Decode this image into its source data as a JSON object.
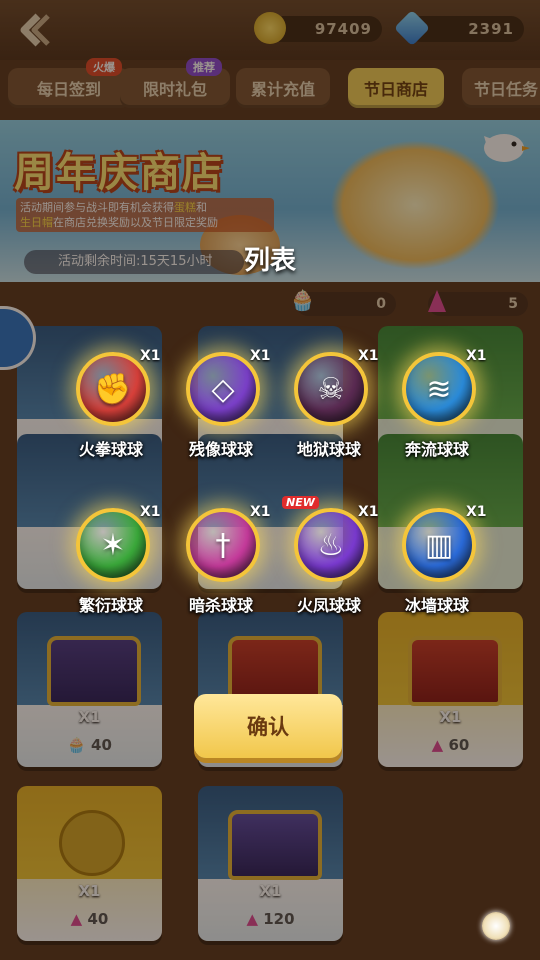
{
  "topbar": {
    "coins": "97409",
    "diamonds": "2391"
  },
  "tabs": [
    {
      "label": "每日签到",
      "tag": "火爆",
      "active": false
    },
    {
      "label": "限时礼包",
      "tag": "推荐",
      "active": false
    },
    {
      "label": "累计充值",
      "tag": "",
      "active": false
    },
    {
      "label": "节日商店",
      "tag": "",
      "active": true
    },
    {
      "label": "节日任务",
      "tag": "",
      "active": false
    }
  ],
  "banner": {
    "title": "周年庆商店",
    "desc_1": "活动期间参与战斗即有机会获得",
    "desc_hl1": "蛋糕",
    "desc_2": "和",
    "desc_hl2": "生日帽",
    "desc_3": "在商店兑换奖励以及节日限定奖励",
    "timer": "活动剩余时间:15天15小时"
  },
  "resources": {
    "cake": "0",
    "hat": "5"
  },
  "shop_cards": [
    {
      "qty": "X1",
      "price": "40"
    },
    {
      "qty": "X1",
      "price": "60"
    },
    {
      "qty": "X1",
      "price": "40"
    },
    {
      "qty": "X1",
      "price": "120"
    }
  ],
  "popup": {
    "title": "列表",
    "confirm_label": "确认",
    "balls": [
      {
        "name": "火拳球球",
        "count": "X1",
        "color": "#d8403a",
        "icon": "fist-icon",
        "glyph": "✊",
        "is_new": false
      },
      {
        "name": "残像球球",
        "count": "X1",
        "color": "#7a3fc8",
        "icon": "afterimage-icon",
        "glyph": "◇",
        "is_new": false
      },
      {
        "name": "地狱球球",
        "count": "X1",
        "color": "#5a2a52",
        "icon": "skull-icon",
        "glyph": "☠",
        "is_new": false
      },
      {
        "name": "奔流球球",
        "count": "X1",
        "color": "#2a8ad8",
        "icon": "wave-icon",
        "glyph": "≋",
        "is_new": false
      },
      {
        "name": "繁衍球球",
        "count": "X1",
        "color": "#3aa83a",
        "icon": "star-icon",
        "glyph": "✶",
        "is_new": false
      },
      {
        "name": "暗杀球球",
        "count": "X1",
        "color": "#c43a9a",
        "icon": "dagger-icon",
        "glyph": "†",
        "is_new": false
      },
      {
        "name": "火凤球球",
        "count": "X1",
        "color": "#7a3ad0",
        "icon": "phoenix-icon",
        "glyph": "♨",
        "is_new": true,
        "new_label": "NEW"
      },
      {
        "name": "冰墙球球",
        "count": "X1",
        "color": "#2a6ad8",
        "icon": "ice-wall-icon",
        "glyph": "▥",
        "is_new": false
      }
    ]
  }
}
